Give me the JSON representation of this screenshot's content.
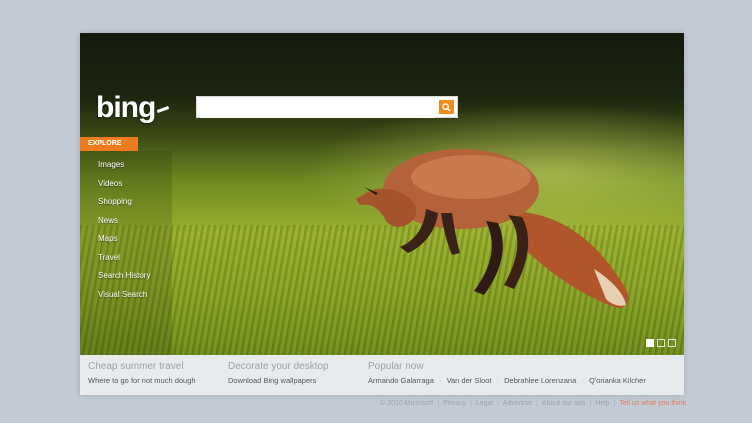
{
  "logo": "bing",
  "search": {
    "placeholder": ""
  },
  "explore_label": "EXPLORE",
  "nav": [
    "Images",
    "Videos",
    "Shopping",
    "News",
    "Maps",
    "Travel",
    "Search History",
    "Visual Search"
  ],
  "footer": {
    "col1": {
      "heading": "Cheap summer travel",
      "link": "Where to go for not much dough"
    },
    "col2": {
      "heading": "Decorate your desktop",
      "link": "Download Bing wallpapers"
    },
    "col3": {
      "heading": "Popular now",
      "links": [
        "Armando Galarraga",
        "Van der Sloot",
        "Debrahlee Lorenzana",
        "Q'orianka Kilcher"
      ]
    }
  },
  "legal": {
    "copyright": "© 2010 Microsoft",
    "links": [
      "Privacy",
      "Legal",
      "Advertise",
      "About our ads",
      "Help"
    ],
    "feedback": "Tell us what you think"
  },
  "colors": {
    "accent": "#ee7c1e",
    "search_button": "#f08c24"
  },
  "icons": {
    "search": "magnifier-icon"
  },
  "pager": {
    "pages": 3,
    "selected": 1
  }
}
